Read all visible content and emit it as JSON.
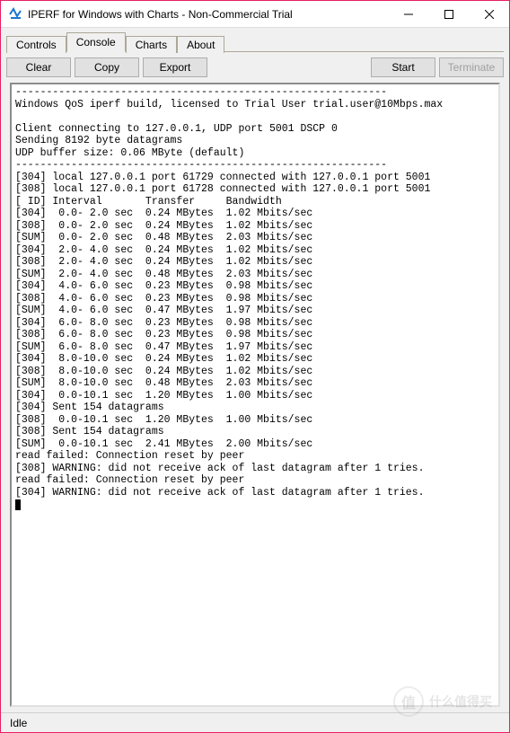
{
  "window": {
    "title": "IPERF for Windows with Charts - Non-Commercial Trial"
  },
  "tabs": {
    "controls": "Controls",
    "console": "Console",
    "charts": "Charts",
    "about": "About"
  },
  "toolbar": {
    "clear": "Clear",
    "copy": "Copy",
    "export": "Export",
    "start": "Start",
    "terminate": "Terminate"
  },
  "console": {
    "text": "------------------------------------------------------------\nWindows QoS iperf build, licensed to Trial User trial.user@10Mbps.max\n\nClient connecting to 127.0.0.1, UDP port 5001 DSCP 0\nSending 8192 byte datagrams\nUDP buffer size: 0.06 MByte (default)\n------------------------------------------------------------\n[304] local 127.0.0.1 port 61729 connected with 127.0.0.1 port 5001\n[308] local 127.0.0.1 port 61728 connected with 127.0.0.1 port 5001\n[ ID] Interval       Transfer     Bandwidth\n[304]  0.0- 2.0 sec  0.24 MBytes  1.02 Mbits/sec\n[308]  0.0- 2.0 sec  0.24 MBytes  1.02 Mbits/sec\n[SUM]  0.0- 2.0 sec  0.48 MBytes  2.03 Mbits/sec\n[304]  2.0- 4.0 sec  0.24 MBytes  1.02 Mbits/sec\n[308]  2.0- 4.0 sec  0.24 MBytes  1.02 Mbits/sec\n[SUM]  2.0- 4.0 sec  0.48 MBytes  2.03 Mbits/sec\n[304]  4.0- 6.0 sec  0.23 MBytes  0.98 Mbits/sec\n[308]  4.0- 6.0 sec  0.23 MBytes  0.98 Mbits/sec\n[SUM]  4.0- 6.0 sec  0.47 MBytes  1.97 Mbits/sec\n[304]  6.0- 8.0 sec  0.23 MBytes  0.98 Mbits/sec\n[308]  6.0- 8.0 sec  0.23 MBytes  0.98 Mbits/sec\n[SUM]  6.0- 8.0 sec  0.47 MBytes  1.97 Mbits/sec\n[304]  8.0-10.0 sec  0.24 MBytes  1.02 Mbits/sec\n[308]  8.0-10.0 sec  0.24 MBytes  1.02 Mbits/sec\n[SUM]  8.0-10.0 sec  0.48 MBytes  2.03 Mbits/sec\n[304]  0.0-10.1 sec  1.20 MBytes  1.00 Mbits/sec\n[304] Sent 154 datagrams\n[308]  0.0-10.1 sec  1.20 MBytes  1.00 Mbits/sec\n[308] Sent 154 datagrams\n[SUM]  0.0-10.1 sec  2.41 MBytes  2.00 Mbits/sec\nread failed: Connection reset by peer\n[308] WARNING: did not receive ack of last datagram after 1 tries.\nread failed: Connection reset by peer\n[304] WARNING: did not receive ack of last datagram after 1 tries."
  },
  "status": {
    "text": "Idle"
  },
  "watermark": {
    "char": "值",
    "text": "什么值得买"
  }
}
